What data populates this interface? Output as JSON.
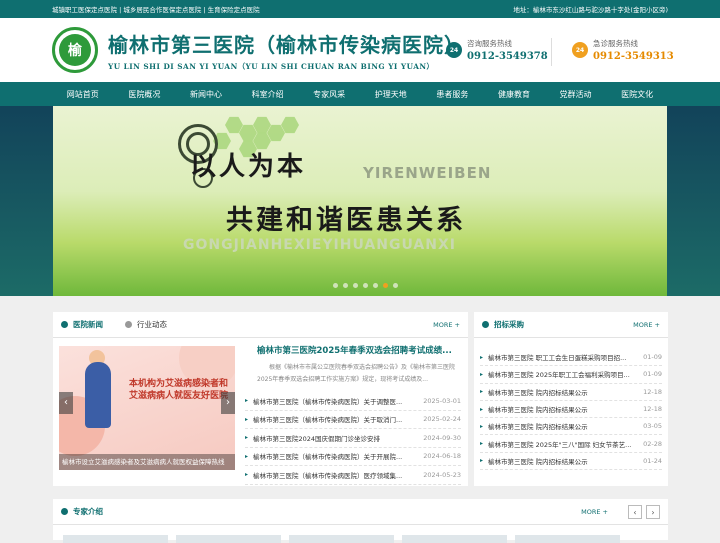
{
  "topbar": {
    "left": "城镇职工医保定点医院 | 城乡居民合作医保定点医院 | 生育保险定点医院",
    "right": "地址：榆林市东沙红山路与驼沙路十字处(金阳小区旁)"
  },
  "header": {
    "logo_char": "榆",
    "title_cn": "榆林市第三医院（榆林市传染病医院）",
    "title_en": "YU LIN SHI DI SAN YI YUAN（YU LIN SHI CHUAN RAN BING YI YUAN）",
    "hotline1": {
      "badge": "24",
      "label": "咨询服务热线",
      "number": "0912-3549378"
    },
    "hotline2": {
      "badge": "24",
      "label": "急诊服务热线",
      "number": "0912-3549313"
    }
  },
  "nav": [
    "网站首页",
    "医院概况",
    "新闻中心",
    "科室介绍",
    "专家风采",
    "护理天地",
    "患者服务",
    "健康教育",
    "党群活动",
    "医院文化"
  ],
  "banner": {
    "line1": "以人为本",
    "line1_en": "YIRENWEIBEN",
    "line2": "共建和谐医患关系",
    "line2_en": "GONGJIANHEXIEYIHUANGUANXI"
  },
  "news": {
    "tab_active": "医院新闻",
    "tab_other": "行业动态",
    "more": "MORE +",
    "photo_text": "本机构为艾滋病感染者和艾滋病病人就医友好医院",
    "photo_caption": "榆林市设立艾滋病感染者及艾滋病病人就医权益保障热线",
    "headline": "榆林市第三医院2025年春季双选会招聘考试成绩...",
    "summary": "根据《榆林市市属公立医院春季双选会招聘公告》及《榆林市第三医院2025年春季双选会招聘工作实施方案》规定，现将考试成绩及...",
    "items": [
      {
        "title": "榆林市第三医院（榆林市传染病医院）关于调整医...",
        "date": "2025-03-01"
      },
      {
        "title": "榆林市第三医院（榆林市传染病医院）关于取消门...",
        "date": "2025-02-24"
      },
      {
        "title": "榆林市第三医院2024国庆假期门诊坐诊安排",
        "date": "2024-09-30"
      },
      {
        "title": "榆林市第三医院（榆林市传染病医院）关于开展院...",
        "date": "2024-06-18"
      },
      {
        "title": "榆林市第三医院（榆林市传染病医院）医疗领域集...",
        "date": "2024-05-23"
      }
    ]
  },
  "recruit": {
    "title": "招标采购",
    "more": "MORE +",
    "items": [
      {
        "title": "榆林市第三医院 职工工会生日蛋糕采购项目招...",
        "date": "01-09"
      },
      {
        "title": "榆林市第三医院 2025年职工工会福利采购项目...",
        "date": "01-09"
      },
      {
        "title": "榆林市第三医院 院内招标结果公示",
        "date": "12-18"
      },
      {
        "title": "榆林市第三医院 院内招标结果公示",
        "date": "12-18"
      },
      {
        "title": "榆林市第三医院 院内招标结果公示",
        "date": "03-05"
      },
      {
        "title": "榆林市第三医院 2025年\"三八\"国际 妇女节茶艺...",
        "date": "02-28"
      },
      {
        "title": "榆林市第三医院 院内招标结果公示",
        "date": "01-24"
      }
    ]
  },
  "experts": {
    "title": "专家介绍",
    "more": "MORE +",
    "prev": "‹",
    "next": "›"
  },
  "colors": {
    "brand": "#0f6f70",
    "accent": "#f0a020",
    "logo_green": "#2e9a3a"
  }
}
